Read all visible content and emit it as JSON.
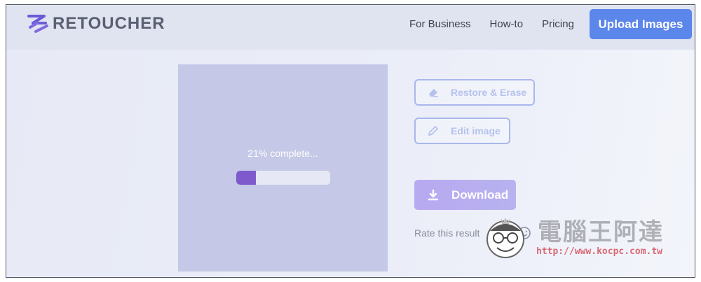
{
  "header": {
    "brand": "RETOUCHER",
    "nav": [
      "For Business",
      "How-to",
      "Pricing"
    ],
    "upload_label": "Upload Images"
  },
  "preview": {
    "progress_text": "21% complete...",
    "progress_fraction": 0.21
  },
  "actions": {
    "restore_label": "Restore & Erase",
    "edit_label": "Edit image",
    "download_label": "Download"
  },
  "rating": {
    "label": "Rate this result",
    "icons": [
      "sad-face-icon",
      "happy-face-icon"
    ]
  },
  "watermark": {
    "title": "電腦王阿達",
    "url": "http://www.kocpc.com.tw"
  },
  "colors": {
    "accent": "#5b86ea",
    "progress": "#7e5acd",
    "preview_bg": "#c5c8e6",
    "download": "#b8a9f0"
  }
}
